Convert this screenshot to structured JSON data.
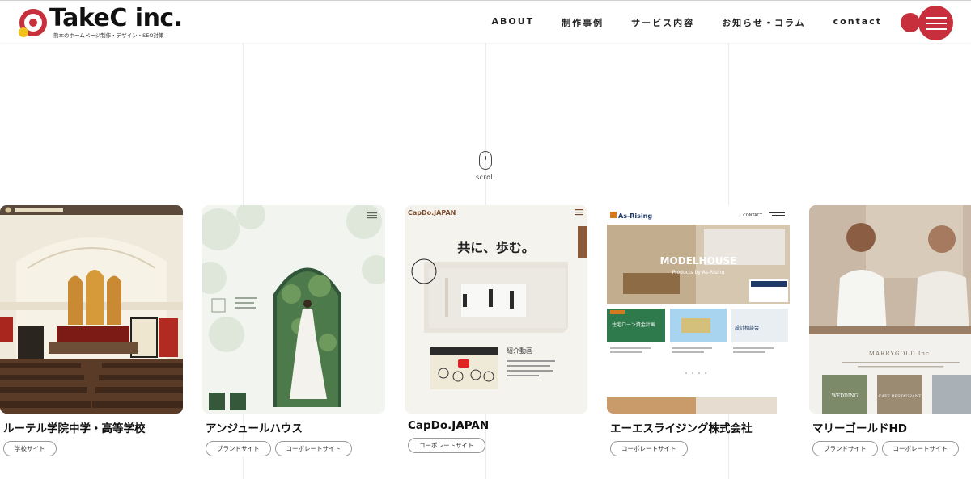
{
  "header": {
    "logo_text": "TakeC inc.",
    "logo_subtitle": "熊本のホームページ制作・デザイン・SEO対策",
    "nav": [
      "ABOUT",
      "制作事例",
      "サービス内容",
      "お知らせ・コラム",
      "contact"
    ],
    "menu_icon": "hamburger-icon"
  },
  "hero": {
    "scroll_label": "scroll"
  },
  "works": [
    {
      "title": "ルーテル学院中学・高等学校",
      "tags": [
        "学校サイト"
      ]
    },
    {
      "title": "アンジュールハウス",
      "tags": [
        "ブランドサイト",
        "コーポレートサイト"
      ]
    },
    {
      "title": "CapDo.JAPAN",
      "tags": [
        "コーポレートサイト"
      ]
    },
    {
      "title": "エーエスライジング株式会社",
      "tags": [
        "コーポレートサイト"
      ]
    },
    {
      "title": "マリーゴールドHD",
      "tags": [
        "ブランドサイト",
        "コーポレートサイト"
      ]
    }
  ],
  "thumbs": {
    "capdo_logo": "CapDo.JAPAN",
    "capdo_heading": "共に、歩む。",
    "capdo_section": "紹介動画",
    "asrising_logo": "As-Rising",
    "asrising_contact": "CONTACT",
    "asrising_hero": "MODELHOUSE",
    "asrising_hero_sub": "Products by As-Rising",
    "asrising_tile1": "住宅ローン資金計画",
    "asrising_tile3": "設計相談会",
    "marry_brand": "MARRYGOLD Inc.",
    "marry_cafe": "CAFE RESTAURANT",
    "marry_wedding": "WEDDING"
  },
  "colors": {
    "accent": "#c62f3b",
    "logo_yellow": "#f2c21a",
    "text": "#222222"
  }
}
